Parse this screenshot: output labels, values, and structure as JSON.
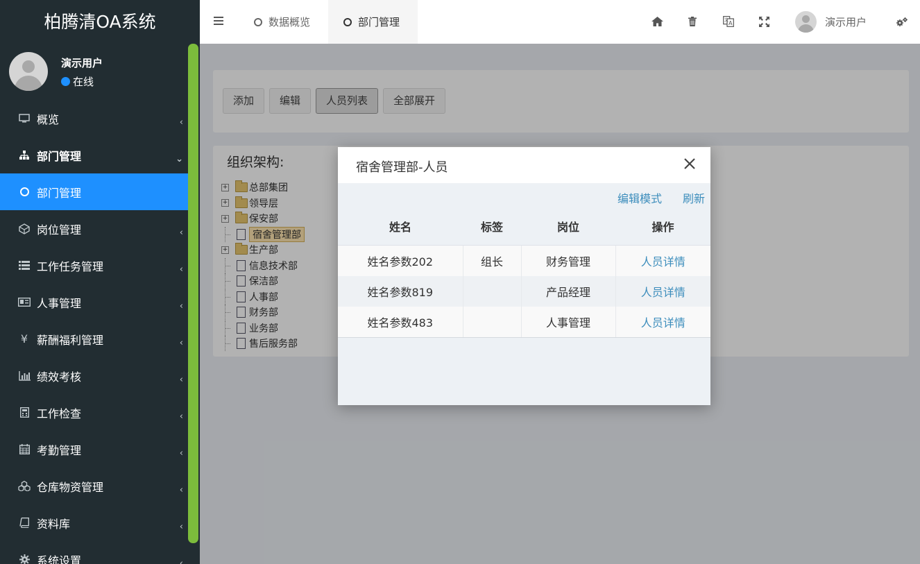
{
  "brand": {
    "title": "柏腾清OA系统"
  },
  "user": {
    "name": "演示用户",
    "status": "在线"
  },
  "sidebar": {
    "items": [
      {
        "label": "概览",
        "icon": "monitor-icon"
      },
      {
        "label": "部门管理",
        "icon": "sitemap-icon",
        "state": "open"
      },
      {
        "label": "部门管理",
        "icon": "circle-icon",
        "state": "active"
      },
      {
        "label": "岗位管理",
        "icon": "cube-icon"
      },
      {
        "label": "工作任务管理",
        "icon": "list-icon"
      },
      {
        "label": "人事管理",
        "icon": "id-card-icon"
      },
      {
        "label": "薪酬福利管理",
        "icon": "yen-icon"
      },
      {
        "label": "绩效考核",
        "icon": "bar-chart-icon"
      },
      {
        "label": "工作检查",
        "icon": "calculator-icon"
      },
      {
        "label": "考勤管理",
        "icon": "calendar-icon"
      },
      {
        "label": "仓库物资管理",
        "icon": "cubes-icon"
      },
      {
        "label": "资料库",
        "icon": "book-icon"
      },
      {
        "label": "系统设置",
        "icon": "gear-icon"
      }
    ]
  },
  "header": {
    "tabs": [
      {
        "label": "数据概览"
      },
      {
        "label": "部门管理"
      }
    ],
    "user_name": "演示用户"
  },
  "toolbar": {
    "add": "添加",
    "edit": "编辑",
    "staff_list": "人员列表",
    "expand_all": "全部展开"
  },
  "tree": {
    "title": "组织架构:",
    "nodes": [
      {
        "label": "总部集团",
        "type": "folder"
      },
      {
        "label": "领导层",
        "type": "folder"
      },
      {
        "label": "保安部",
        "type": "folder"
      },
      {
        "label": "宿舍管理部",
        "type": "file",
        "selected": true
      },
      {
        "label": "生产部",
        "type": "folder"
      },
      {
        "label": "信息技术部",
        "type": "file"
      },
      {
        "label": "保洁部",
        "type": "file"
      },
      {
        "label": "人事部",
        "type": "file"
      },
      {
        "label": "财务部",
        "type": "file"
      },
      {
        "label": "业务部",
        "type": "file"
      },
      {
        "label": "售后服务部",
        "type": "file"
      }
    ]
  },
  "modal": {
    "title": "宿舍管理部-人员",
    "edit_mode": "编辑模式",
    "refresh": "刷新",
    "columns": [
      "姓名",
      "标签",
      "岗位",
      "操作"
    ],
    "rows": [
      {
        "name": "姓名参数202",
        "tag": "组长",
        "position": "财务管理",
        "action": "人员详情"
      },
      {
        "name": "姓名参数819",
        "tag": "",
        "position": "产品经理",
        "action": "人员详情"
      },
      {
        "name": "姓名参数483",
        "tag": "",
        "position": "人事管理",
        "action": "人员详情"
      }
    ]
  },
  "colors": {
    "sidebar_bg": "#222d32",
    "active_blue": "#1e90ff",
    "scroll_green": "#7cbc3c",
    "link": "#3c8dbc"
  }
}
